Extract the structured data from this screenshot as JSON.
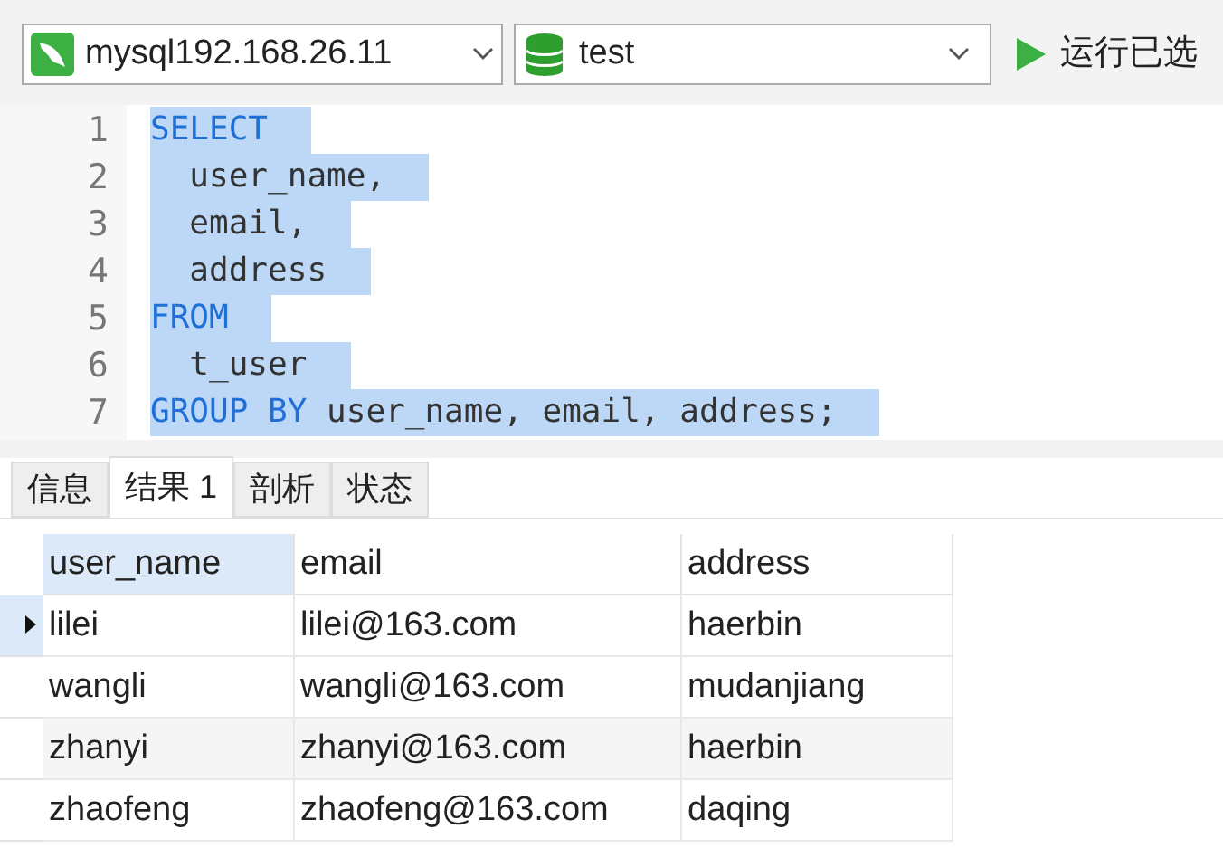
{
  "toolbar": {
    "connection": "mysql192.168.26.11",
    "database": "test",
    "run_button": "运行已选"
  },
  "editor": {
    "lines": [
      {
        "number": "1",
        "selected": true,
        "tokens": [
          {
            "kind": "keyword",
            "text": "SELECT"
          }
        ]
      },
      {
        "number": "2",
        "selected": true,
        "tokens": [
          {
            "kind": "ident",
            "text": "  user_name,"
          }
        ]
      },
      {
        "number": "3",
        "selected": true,
        "tokens": [
          {
            "kind": "ident",
            "text": "  email,"
          }
        ]
      },
      {
        "number": "4",
        "selected": true,
        "tokens": [
          {
            "kind": "ident",
            "text": "  address"
          }
        ]
      },
      {
        "number": "5",
        "selected": true,
        "tokens": [
          {
            "kind": "keyword",
            "text": "FROM"
          }
        ]
      },
      {
        "number": "6",
        "selected": true,
        "tokens": [
          {
            "kind": "ident",
            "text": "  t_user"
          }
        ]
      },
      {
        "number": "7",
        "selected": true,
        "tokens": [
          {
            "kind": "keyword",
            "text": "GROUP BY"
          },
          {
            "kind": "ident",
            "text": " user_name, email, address;"
          }
        ]
      }
    ]
  },
  "tabs": [
    {
      "label": "信息",
      "selected": false
    },
    {
      "label": "结果 1",
      "selected": true
    },
    {
      "label": "剖析",
      "selected": false
    },
    {
      "label": "状态",
      "selected": false
    }
  ],
  "table": {
    "columns": [
      {
        "label": "user_name",
        "selected": true
      },
      {
        "label": "email",
        "selected": false
      },
      {
        "label": "address",
        "selected": false
      }
    ],
    "rows": [
      {
        "selected": true,
        "cells": [
          "lilei",
          "lilei@163.com",
          "haerbin"
        ]
      },
      {
        "selected": false,
        "cells": [
          "wangli",
          "wangli@163.com",
          "mudanjiang"
        ]
      },
      {
        "selected": false,
        "cells": [
          "zhanyi",
          "zhanyi@163.com",
          "haerbin"
        ]
      },
      {
        "selected": false,
        "cells": [
          "zhaofeng",
          "zhaofeng@163.com",
          "daqing"
        ]
      }
    ]
  }
}
